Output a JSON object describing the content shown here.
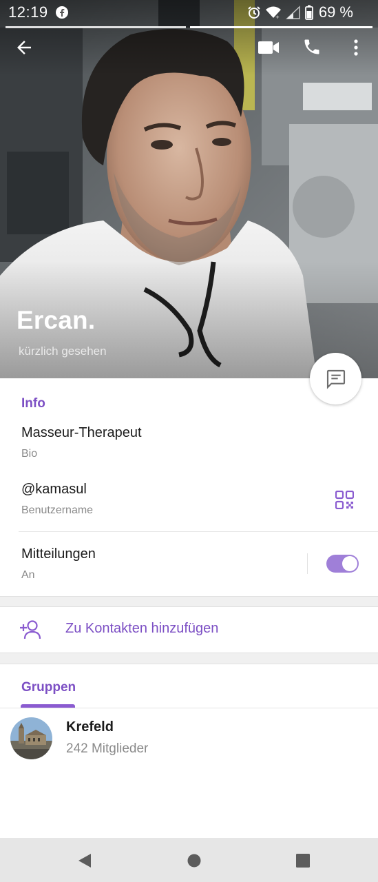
{
  "status_bar": {
    "time": "12:19",
    "battery": "69 %",
    "icons": [
      "facebook-icon",
      "alarm-icon",
      "wifi-icon",
      "signal-icon",
      "battery-icon"
    ]
  },
  "toolbar": {
    "icons": [
      "back-arrow-icon",
      "video-call-icon",
      "phone-icon",
      "more-vert-icon"
    ]
  },
  "profile": {
    "name": "Ercan.",
    "status": "kürzlich gesehen"
  },
  "info": {
    "section_title": "Info",
    "bio_value": "Masseur-Therapeut",
    "bio_label": "Bio",
    "username_value": "@kamasul",
    "username_label": "Benutzername",
    "notifications_value": "Mitteilungen",
    "notifications_state": "An",
    "notifications_enabled": true
  },
  "actions": {
    "add_contact": "Zu Kontakten hinzufügen"
  },
  "tabs": {
    "groups": "Gruppen"
  },
  "groups": [
    {
      "name": "Krefeld",
      "members": "242 Mitglieder"
    }
  ],
  "colors": {
    "accent": "#7c4fc4",
    "toggle_on": "#9f7fd8",
    "section_gap": "#f0f0f0",
    "nav_bar": "#e6e6e6"
  }
}
